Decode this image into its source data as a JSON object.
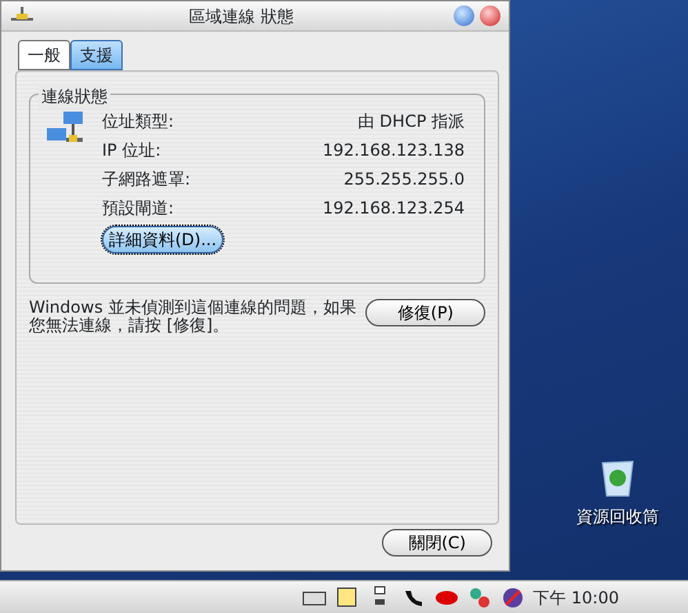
{
  "window": {
    "title": "區域連線 狀態"
  },
  "tabs": [
    {
      "label": "一般",
      "selected": false
    },
    {
      "label": "支援",
      "selected": true
    }
  ],
  "group": {
    "title": "連線狀態",
    "rows": [
      {
        "label": "位址類型:",
        "value": "由 DHCP 指派"
      },
      {
        "label": "IP 位址:",
        "value": "192.168.123.138"
      },
      {
        "label": "子網路遮罩:",
        "value": "255.255.255.0"
      },
      {
        "label": "預設閘道:",
        "value": "192.168.123.254"
      }
    ],
    "details_button": "詳細資料(D)..."
  },
  "message": "Windows 並未偵測到這個連線的問題，如果您無法連線，請按 [修復]。",
  "repair_button": "修復(P)",
  "close_button": "關閉(C)",
  "desktop": {
    "icon_label": "資源回收筒"
  },
  "taskbar": {
    "clock": "下午 10:00"
  }
}
